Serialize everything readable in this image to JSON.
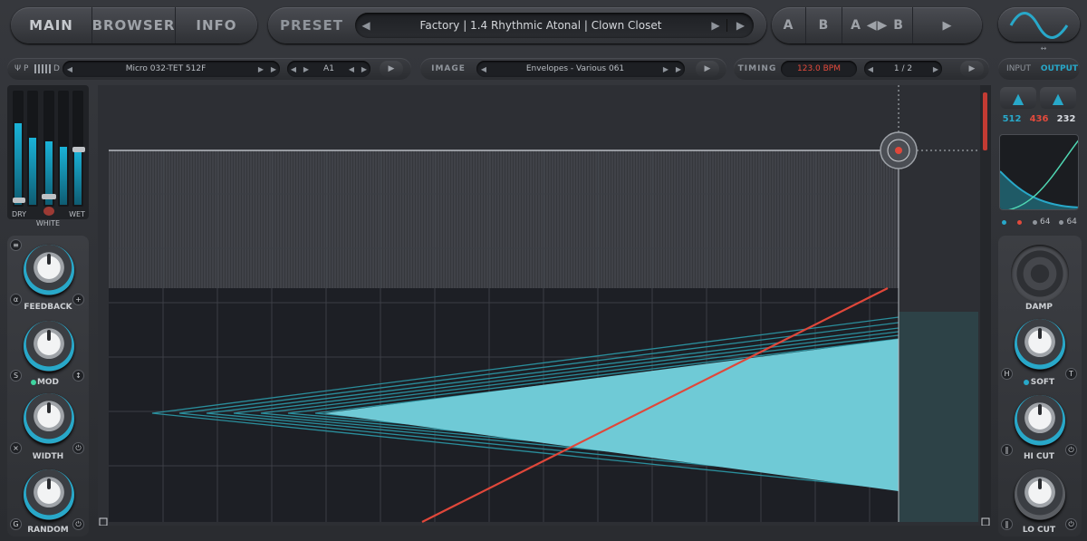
{
  "nav": {
    "tabs": [
      "MAIN",
      "BROWSER",
      "INFO"
    ]
  },
  "preset": {
    "label": "PRESET",
    "name": "Factory | 1.4 Rhythmic Atonal | Clown Closet",
    "prev_icon": "chevron-left-icon",
    "next_icon": "chevron-right-icon"
  },
  "ab": {
    "a": "A",
    "b": "B",
    "ab": "A ◀▶ B",
    "play_icon": "play-icon"
  },
  "row2": {
    "tuning_prefix": "Ψ P",
    "tuning_suffix": "D",
    "tuning": "Micro 032-TET 512F",
    "key": "A1",
    "image_label": "IMAGE",
    "image": "Envelopes - Various 061",
    "timing_label": "TIMING",
    "bpm": "123.0 BPM",
    "division": "1 / 2",
    "input": "INPUT",
    "output": "OUTPUT"
  },
  "left": {
    "dry": "DRY",
    "white": "WHITE",
    "wet": "WET",
    "feedback": "FEEDBACK",
    "mod": "MOD",
    "width": "WIDTH",
    "random": "RANDOM",
    "meters": [
      0.7,
      0.55,
      0.5
    ]
  },
  "right": {
    "num1": "512",
    "num2": "436",
    "num3": "232",
    "val_a": "64",
    "val_b": "64",
    "damp": "DAMP",
    "soft": "SOFT",
    "hicut": "HI CUT",
    "locut": "LO CUT"
  },
  "colors": {
    "accent": "#28a8c9",
    "cyan_fill": "#6fcad6",
    "red": "#e0473a",
    "bpm": "#e24a3c"
  }
}
